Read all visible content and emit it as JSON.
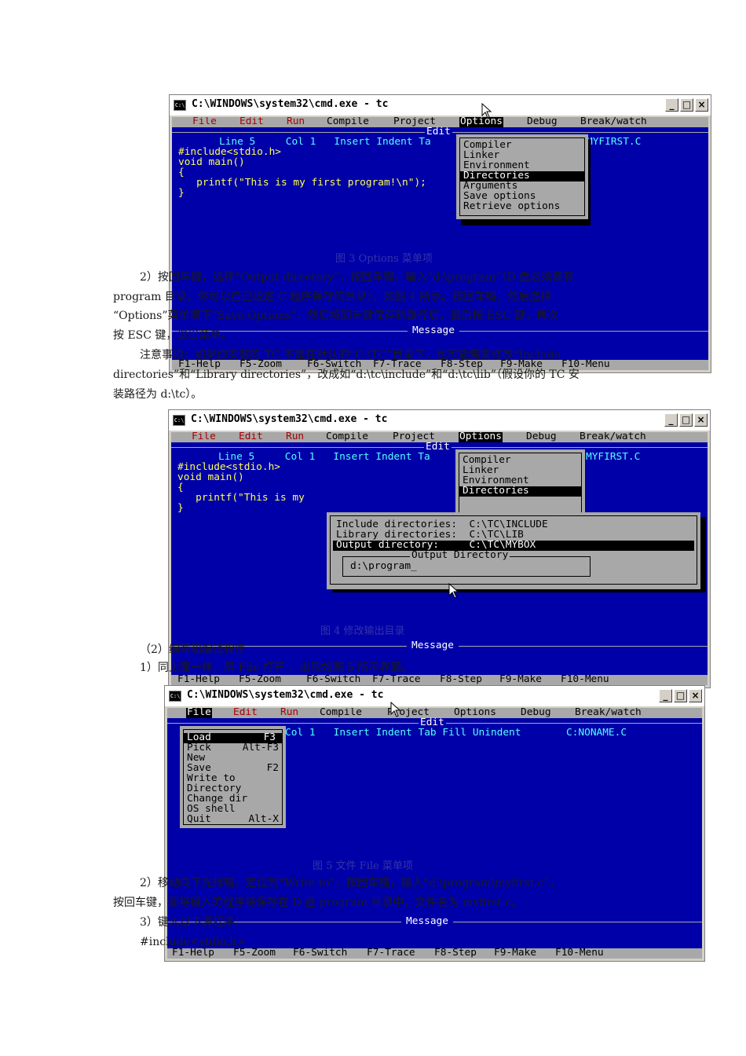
{
  "paragraphs": [
    "2）按回车键，选择“Output directory”，按回车键，输入“d:\\program”（D 盘必须要有",
    "program 目录，你可以自己设定 C 程序保存的目录），如图 4 所示。按回车键，然后选择",
    "“Options”菜单项下“Save Options”，然后按回车键保存新路径后，最后按 ESC 键，再次",
    "按 ESC 键，退出菜单。",
    "注意事项：如果你安装的 TC 不是在默认的“C:\\TC”目录下，也可能需要修改“Include",
    "directories”和“Library directories”，改成如“d:\\tc\\include”和“d:\\tc\\lib”（假设你的 TC 安",
    "装路径为 d:\\tc）。"
  ],
  "section2": "（2）编写和编译程序",
  "step1": "1）同上面一样，用 File 打开 ，出现如图 5 所示界面。",
  "step2a": "2）移动向下光标键，定位到“Write to”，按回车键，输入“d:\\program\\myfirst.c”，",
  "step2b": "按回车键，即将键入的程序将保存在 D 盘 program 目录中，文件名为 myfirst.c。",
  "step3": "3）键入以下源程序：",
  "code_line": "#include<stdio.h>",
  "captions": {
    "fig3": "图 3 Options 菜单项",
    "fig4": "图 4 修改输出目录",
    "fig5": "图 5 文件 File 菜单项"
  },
  "window": {
    "icon_text": "C:\\",
    "title": "C:\\WINDOWS\\system32\\cmd.exe - tc",
    "buttons": [
      "_",
      "□",
      "×"
    ]
  },
  "menubar": {
    "file": "File",
    "edit": "Edit",
    "run": "Run",
    "compile": "Compile",
    "project": "Project",
    "options": "Options",
    "debug": "Debug",
    "break_watch": "Break/watch"
  },
  "editor": {
    "edit_title": "Edit",
    "status1": "Line 5     Col 1   Insert Indent Ta",
    "file1": "MYFIRST.C",
    "status3": "Col 1   Insert Indent Tab Fill Unindent",
    "file3": "C:NONAME.C",
    "code": [
      "#include<stdio.h>",
      "void main()",
      "{",
      "   printf(\"This is my first program!\\n\");",
      "}"
    ],
    "code2_printf": "   printf(\"This is my"
  },
  "message_label": "Message",
  "fkeys": [
    "F1-Help",
    "F5-Zoom",
    "F6-Switch",
    "F7-Trace",
    "F8-Step",
    "F9-Make",
    "F10-Menu"
  ],
  "options_menu": [
    "Compiler",
    "Linker",
    "Environment",
    "Directories",
    "Arguments",
    "Save options",
    "Retrieve options"
  ],
  "options_menu_short": [
    "Compiler",
    "Linker",
    "Environment",
    "Directories"
  ],
  "directories_dialog": {
    "include_label": "Include directories:",
    "include_value": "C:\\TC\\INCLUDE",
    "library_label": "Library directories:",
    "library_value": "C:\\TC\\LIB",
    "output_label": "Output directory:",
    "output_value": "C:\\TC\\MYBOX",
    "input_title": "Output Directory",
    "input_value": "d:\\program_"
  },
  "file_menu": [
    {
      "label": "Load",
      "key": "F3"
    },
    {
      "label": "Pick",
      "key": "Alt-F3"
    },
    {
      "label": "New",
      "key": ""
    },
    {
      "label": "Save",
      "key": "F2"
    },
    {
      "label": "Write to",
      "key": ""
    },
    {
      "label": "Directory",
      "key": ""
    },
    {
      "label": "Change dir",
      "key": ""
    },
    {
      "label": "OS shell",
      "key": ""
    },
    {
      "label": "Quit",
      "key": "Alt-X"
    }
  ],
  "colors": {
    "screen_bg": "#0000a8",
    "menu_bg": "#a8a8a8",
    "hotkey": "#a80000",
    "code": "#ffff55",
    "status": "#55ffff"
  }
}
